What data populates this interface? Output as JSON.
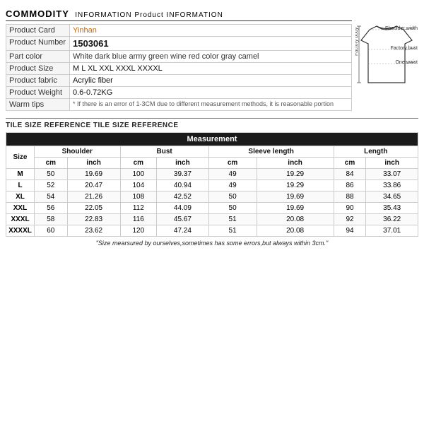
{
  "commodity": {
    "header": "COMMODITY",
    "subheader": "INFORMATION Product INFORMATION"
  },
  "product_info": {
    "fields": [
      {
        "label": "Product Card",
        "value": "Yinhan"
      },
      {
        "label": "Product Number",
        "value": "1503061"
      },
      {
        "label": "Part color",
        "value": "White dark blue army green wine red color gray camel"
      },
      {
        "label": "Product Size",
        "value": "M   L   XL   XXL   XXXL   XXXXL"
      },
      {
        "label": "Product fabric",
        "value": "Acrylic fiber"
      },
      {
        "label": "Product Weight",
        "value": "0.6-0.72KG"
      },
      {
        "label": "Warm tips",
        "value": "* If there is an error of 1-3CM due to different measurement methods, it is reasonable portion"
      }
    ]
  },
  "diagram": {
    "labels": [
      "Shoulder width",
      "Factory bust",
      "One-waist",
      "Factory body"
    ]
  },
  "tile_header": "TILE SIZE REFERENCE TILE SIZE REFERENCE",
  "measurement_table": {
    "title": "Measurement",
    "col_groups": [
      "Shoulder",
      "Bust",
      "Sleeve length",
      "Length"
    ],
    "sub_cols": [
      "cm",
      "inch"
    ],
    "size_label": "Size",
    "rows": [
      {
        "size": "M",
        "shoulder_cm": "50",
        "shoulder_inch": "19.69",
        "bust_cm": "100",
        "bust_inch": "39.37",
        "sleeve_cm": "49",
        "sleeve_inch": "19.29",
        "length_cm": "84",
        "length_inch": "33.07"
      },
      {
        "size": "L",
        "shoulder_cm": "52",
        "shoulder_inch": "20.47",
        "bust_cm": "104",
        "bust_inch": "40.94",
        "sleeve_cm": "49",
        "sleeve_inch": "19.29",
        "length_cm": "86",
        "length_inch": "33.86"
      },
      {
        "size": "XL",
        "shoulder_cm": "54",
        "shoulder_inch": "21.26",
        "bust_cm": "108",
        "bust_inch": "42.52",
        "sleeve_cm": "50",
        "sleeve_inch": "19.69",
        "length_cm": "88",
        "length_inch": "34.65"
      },
      {
        "size": "XXL",
        "shoulder_cm": "56",
        "shoulder_inch": "22.05",
        "bust_cm": "112",
        "bust_inch": "44.09",
        "sleeve_cm": "50",
        "sleeve_inch": "19.69",
        "length_cm": "90",
        "length_inch": "35.43"
      },
      {
        "size": "XXXL",
        "shoulder_cm": "58",
        "shoulder_inch": "22.83",
        "bust_cm": "116",
        "bust_inch": "45.67",
        "sleeve_cm": "51",
        "sleeve_inch": "20.08",
        "length_cm": "92",
        "length_inch": "36.22"
      },
      {
        "size": "XXXXL",
        "shoulder_cm": "60",
        "shoulder_inch": "23.62",
        "bust_cm": "120",
        "bust_inch": "47.24",
        "sleeve_cm": "51",
        "sleeve_inch": "20.08",
        "length_cm": "94",
        "length_inch": "37.01"
      }
    ]
  },
  "note": "\"Size mearsured by ourselves,sometimes has some errors,but always within 3cm.\""
}
